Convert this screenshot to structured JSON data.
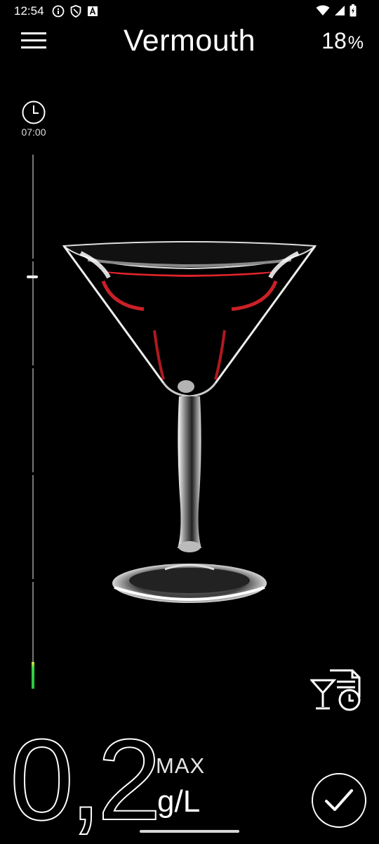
{
  "status_bar": {
    "time": "12:54",
    "left_icons": [
      "info-icon",
      "shield-icon",
      "font-app-icon"
    ],
    "right_icons": [
      "wifi-icon",
      "cellular-signal-icon",
      "battery-icon"
    ]
  },
  "app_bar": {
    "title": "Vermouth",
    "abv_value": "18",
    "abv_unit": "%"
  },
  "clock": {
    "time": "07:00"
  },
  "timeline": {
    "level_fraction": 0.05
  },
  "reading": {
    "value": "0,2",
    "max_label": "MAX",
    "unit": "g/L"
  },
  "colors": {
    "background": "#000000",
    "foreground": "#ffffff",
    "level_green": "#2bc43f",
    "level_yellow": "#e8e23b",
    "wine_red": "#e0242b"
  }
}
